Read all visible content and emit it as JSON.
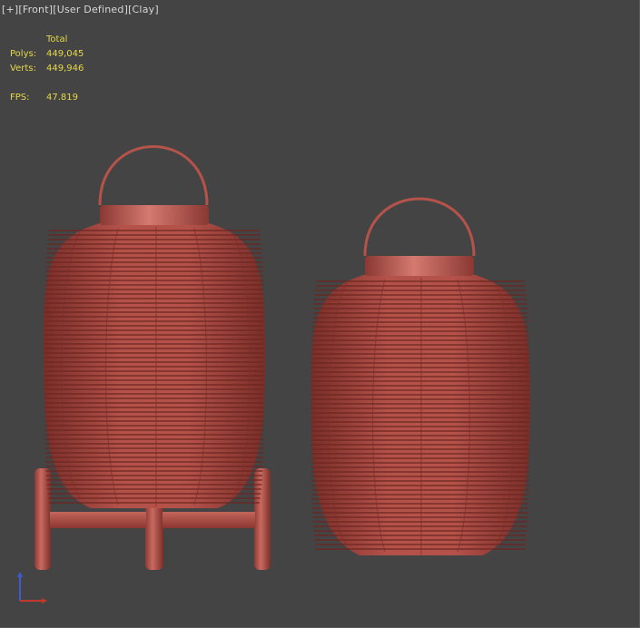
{
  "viewport": {
    "label_parts": [
      "[+]",
      "[Front]",
      "[User Defined]",
      "[Clay]"
    ],
    "stats": {
      "header": "Total",
      "polys_label": "Polys:",
      "polys_value": "449,045",
      "verts_label": "Verts:",
      "verts_value": "449,946",
      "fps_label": "FPS:",
      "fps_value": "47.819"
    }
  },
  "colors": {
    "background": "#444444",
    "clay": "#b5524a",
    "clay_dark": "#7e2f2a",
    "stats_text": "#e6d84a",
    "label_text": "#d8d8d8"
  },
  "objects": [
    {
      "name": "lantern-with-stand",
      "icon": "lantern"
    },
    {
      "name": "lantern",
      "icon": "lantern"
    }
  ]
}
